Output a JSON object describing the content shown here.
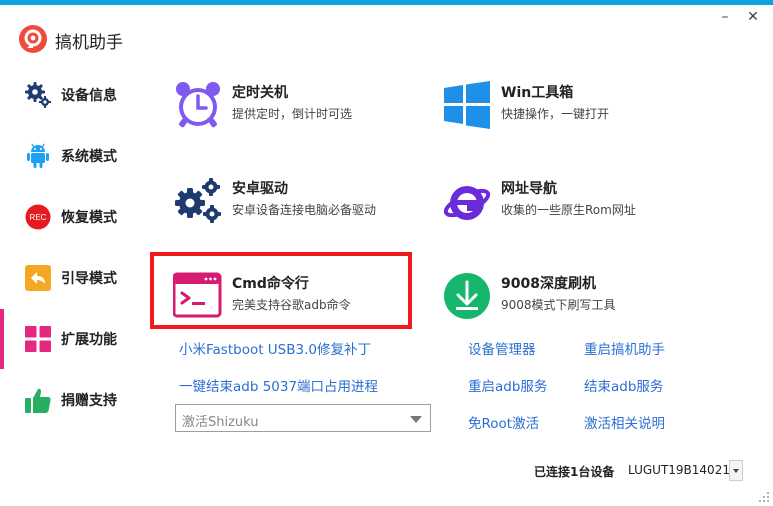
{
  "app": {
    "title": "搞机助手",
    "accent": "#0aa5df",
    "highlight": "#f0191f"
  },
  "window": {
    "minimize": "–",
    "close": "✕"
  },
  "sidebar": {
    "items": [
      {
        "label": "设备信息",
        "icon": "gear-icon"
      },
      {
        "label": "系统模式",
        "icon": "android-icon"
      },
      {
        "label": "恢复模式",
        "icon": "rec-icon",
        "badge": "REC"
      },
      {
        "label": "引导模式",
        "icon": "back-arrow-icon"
      },
      {
        "label": "扩展功能",
        "icon": "grid-icon",
        "active": true
      },
      {
        "label": "捐赠支持",
        "icon": "thumbs-up-icon"
      }
    ]
  },
  "cards": [
    {
      "title": "定时关机",
      "desc": "提供定时，倒计时可选",
      "icon": "alarm-clock-icon"
    },
    {
      "title": "Win工具箱",
      "desc": "快捷操作，一键打开",
      "icon": "windows-logo-icon"
    },
    {
      "title": "安卓驱动",
      "desc": "安卓设备连接电脑必备驱动",
      "icon": "gears-icon"
    },
    {
      "title": "网址导航",
      "desc": "收集的一些原生Rom网址",
      "icon": "ie-logo-icon"
    },
    {
      "title": "Cmd命令行",
      "desc": "完美支持谷歌adb命令",
      "icon": "terminal-icon"
    },
    {
      "title": "9008深度刷机",
      "desc": "9008模式下刷写工具",
      "icon": "download-icon"
    }
  ],
  "links": {
    "fastboot_fix": "小米Fastboot USB3.0修复补丁",
    "kill_adb": "一键结束adb 5037端口占用进程",
    "device_manager": "设备管理器",
    "restart_app": "重启搞机助手",
    "restart_adb": "重启adb服务",
    "stop_adb": "结束adb服务",
    "root_free": "免Root激活",
    "activation_help": "激活相关说明"
  },
  "shizuku": {
    "selected": "激活Shizuku"
  },
  "status": {
    "connected": "已连接1台设备",
    "device": "LUGUT19B14021"
  }
}
